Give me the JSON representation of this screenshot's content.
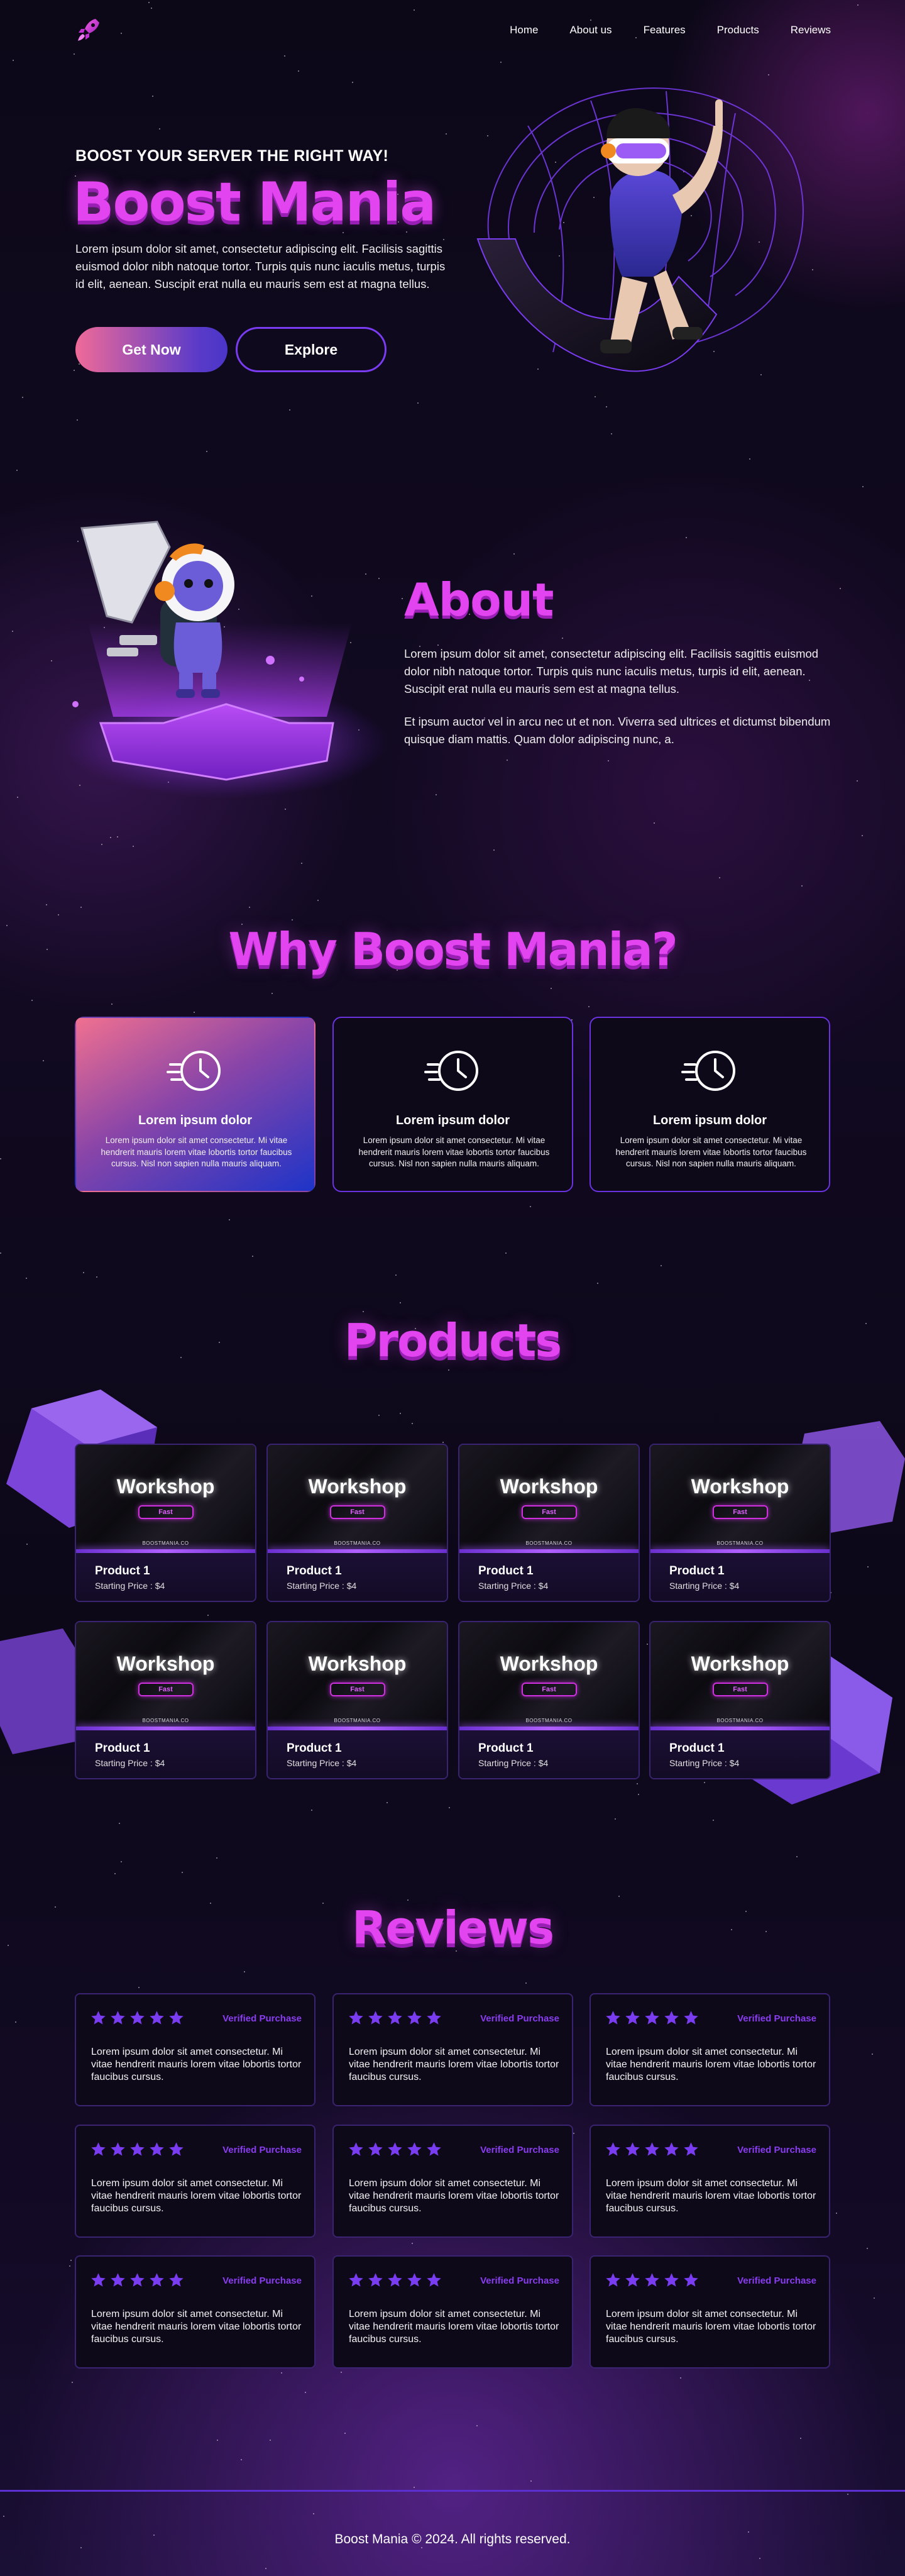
{
  "nav": {
    "links": [
      "Home",
      "About us",
      "Features",
      "Products",
      "Reviews"
    ]
  },
  "hero": {
    "eyebrow": "BOOST YOUR SERVER THE RIGHT WAY!",
    "title": "Boost Mania",
    "text": "Lorem ipsum dolor sit amet, consectetur adipiscing elit. Facilisis sagittis euismod dolor nibh natoque tortor. Turpis quis nunc iaculis metus, turpis id elit, aenean. Suscipit erat nulla eu mauris sem est at magna tellus.",
    "primary_button": "Get Now",
    "secondary_button": "Explore"
  },
  "about": {
    "title": "About",
    "p1": "Lorem ipsum dolor sit amet, consectetur adipiscing elit. Facilisis sagittis euismod dolor nibh natoque tortor. Turpis quis nunc iaculis metus, turpis id elit, aenean. Suscipit erat nulla eu mauris sem est at magna tellus.",
    "p2": "Et ipsum auctor vel in arcu nec ut et non. Viverra sed ultrices et dictumst bibendum quisque diam mattis. Quam dolor adipiscing nunc, a."
  },
  "why": {
    "title": "Why Boost Mania?",
    "cards": [
      {
        "title": "Lorem ipsum dolor",
        "text": "Lorem ipsum dolor sit amet consectetur. Mi vitae hendrerit mauris lorem vitae lobortis tortor faucibus cursus. Nisl non sapien nulla mauris aliquam."
      },
      {
        "title": "Lorem ipsum dolor",
        "text": "Lorem ipsum dolor sit amet consectetur. Mi vitae hendrerit mauris lorem vitae lobortis tortor faucibus cursus. Nisl non sapien nulla mauris aliquam."
      },
      {
        "title": "Lorem ipsum dolor",
        "text": "Lorem ipsum dolor sit amet consectetur. Mi vitae hendrerit mauris lorem vitae lobortis tortor faucibus cursus. Nisl non sapien nulla mauris aliquam."
      }
    ]
  },
  "products": {
    "title": "Products",
    "thumb_title": "Workshop",
    "thumb_badge": "Fast",
    "thumb_brand": "BOOSTMANIA.CO",
    "items": [
      {
        "name": "Product 1",
        "price": "Starting Price : $4"
      },
      {
        "name": "Product 1",
        "price": "Starting Price : $4"
      },
      {
        "name": "Product 1",
        "price": "Starting Price : $4"
      },
      {
        "name": "Product 1",
        "price": "Starting Price : $4"
      },
      {
        "name": "Product 1",
        "price": "Starting Price : $4"
      },
      {
        "name": "Product 1",
        "price": "Starting Price : $4"
      },
      {
        "name": "Product 1",
        "price": "Starting Price : $4"
      },
      {
        "name": "Product 1",
        "price": "Starting Price : $4"
      }
    ]
  },
  "reviews": {
    "title": "Reviews",
    "items": [
      {
        "rating": 5,
        "badge": "Verified Purchase",
        "text": "Lorem ipsum dolor sit amet consectetur. Mi vitae hendrerit mauris lorem vitae lobortis tortor faucibus cursus."
      },
      {
        "rating": 5,
        "badge": "Verified Purchase",
        "text": "Lorem ipsum dolor sit amet consectetur. Mi vitae hendrerit mauris lorem vitae lobortis tortor faucibus cursus."
      },
      {
        "rating": 5,
        "badge": "Verified Purchase",
        "text": "Lorem ipsum dolor sit amet consectetur. Mi vitae hendrerit mauris lorem vitae lobortis tortor faucibus cursus."
      },
      {
        "rating": 5,
        "badge": "Verified Purchase",
        "text": "Lorem ipsum dolor sit amet consectetur. Mi vitae hendrerit mauris lorem vitae lobortis tortor faucibus cursus."
      },
      {
        "rating": 5,
        "badge": "Verified Purchase",
        "text": "Lorem ipsum dolor sit amet consectetur. Mi vitae hendrerit mauris lorem vitae lobortis tortor faucibus cursus."
      },
      {
        "rating": 5,
        "badge": "Verified Purchase",
        "text": "Lorem ipsum dolor sit amet consectetur. Mi vitae hendrerit mauris lorem vitae lobortis tortor faucibus cursus."
      },
      {
        "rating": 5,
        "badge": "Verified Purchase",
        "text": "Lorem ipsum dolor sit amet consectetur. Mi vitae hendrerit mauris lorem vitae lobortis tortor faucibus cursus."
      },
      {
        "rating": 5,
        "badge": "Verified Purchase",
        "text": "Lorem ipsum dolor sit amet consectetur. Mi vitae hendrerit mauris lorem vitae lobortis tortor faucibus cursus."
      },
      {
        "rating": 5,
        "badge": "Verified Purchase",
        "text": "Lorem ipsum dolor sit amet consectetur. Mi vitae hendrerit mauris lorem vitae lobortis tortor faucibus cursus."
      }
    ]
  },
  "footer": {
    "text": "Boost Mania © 2024. All rights reserved."
  },
  "colors": {
    "background": "#0c0818",
    "accent_magenta": "#e244f0",
    "accent_purple": "#7a3cf0",
    "verified": "#8a3cf0"
  },
  "icons": [
    "rocket-logo-icon",
    "fast-clock-icon",
    "star-icon"
  ]
}
